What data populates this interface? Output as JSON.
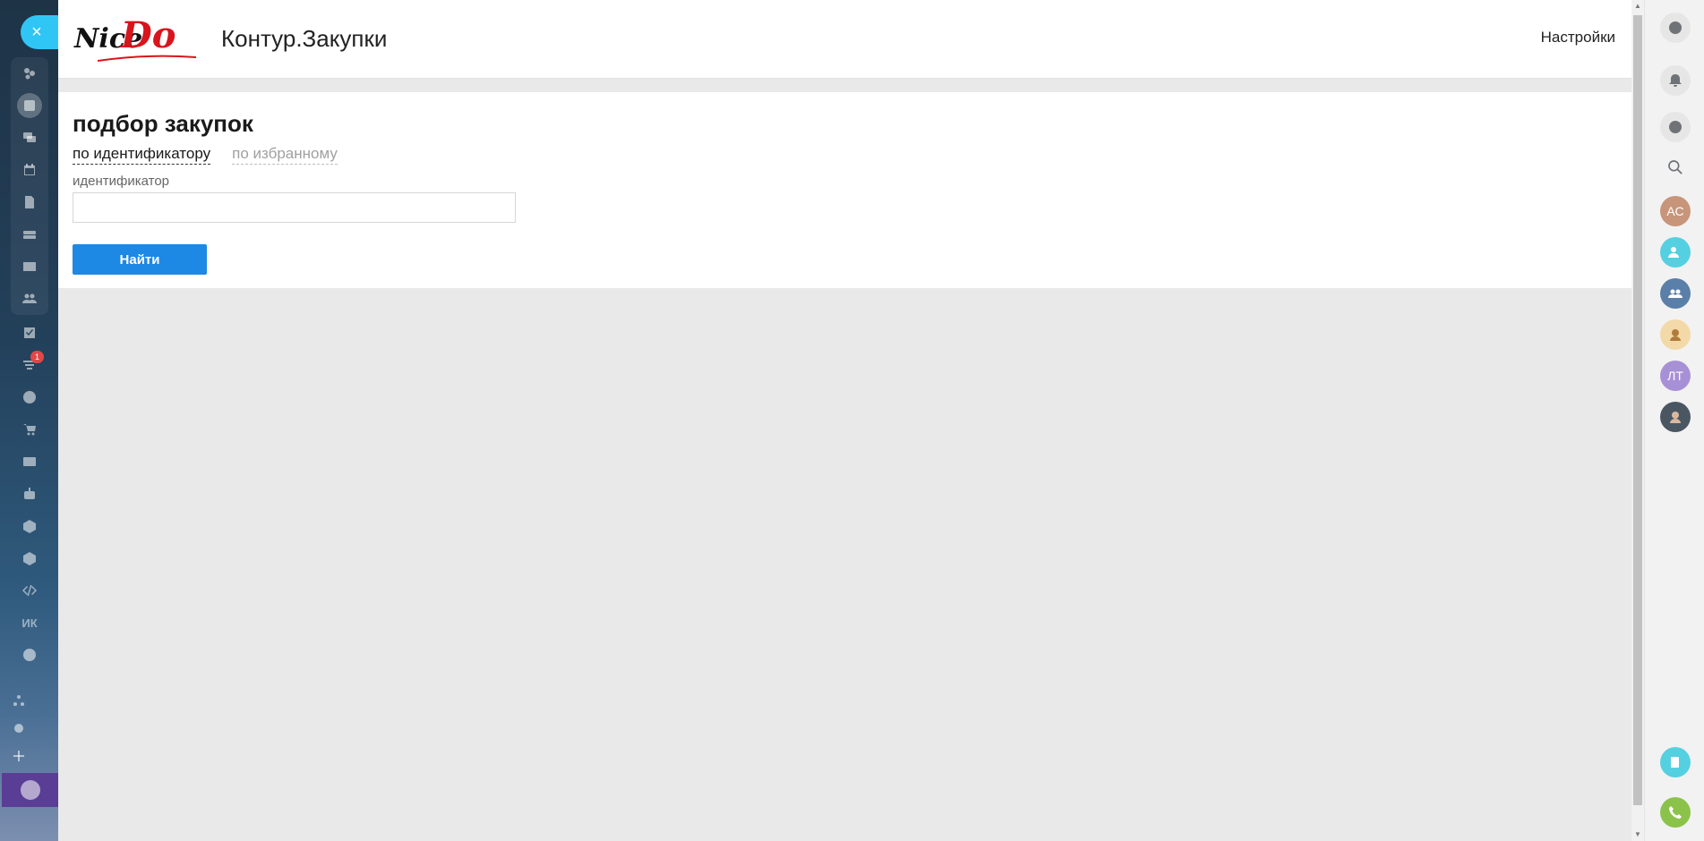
{
  "sidebar_left": {
    "close_symbol": "×",
    "items": [
      {
        "icon": "activity-stream-icon"
      },
      {
        "icon": "feed-icon",
        "active": true
      },
      {
        "icon": "chat-icon"
      },
      {
        "icon": "calendar-icon"
      },
      {
        "icon": "documents-icon"
      },
      {
        "icon": "drive-icon"
      },
      {
        "icon": "mail-icon"
      },
      {
        "icon": "groups-icon"
      },
      {
        "icon": "tasks-icon"
      },
      {
        "icon": "crm-icon",
        "counter": "1"
      },
      {
        "icon": "marketing-icon"
      },
      {
        "icon": "shop-icon"
      },
      {
        "icon": "contact-card-icon"
      },
      {
        "icon": "robot-icon"
      },
      {
        "icon": "box-icon"
      },
      {
        "icon": "box-icon-2"
      },
      {
        "icon": "code-icon"
      },
      {
        "text": "ИК"
      },
      {
        "icon": "more-icon"
      }
    ],
    "bottom": [
      {
        "icon": "sitemap-icon"
      },
      {
        "icon": "settings-icon"
      },
      {
        "icon": "add-icon"
      }
    ]
  },
  "header": {
    "logo_word1": "Nice",
    "logo_word2": "Do",
    "app_title": "Контур.Закупки",
    "settings_label": "Настройки"
  },
  "main": {
    "page_title": "подбор закупок",
    "tabs": [
      {
        "label": "по идентификатору",
        "active": true
      },
      {
        "label": "по избранному",
        "active": false
      }
    ],
    "field_label": "идентификатор",
    "field_value": "",
    "find_button": "Найти"
  },
  "sidebar_right": {
    "avatars": [
      {
        "initials": "АС",
        "color": "#c7957a"
      },
      {
        "initials": "ЛТ",
        "color": "#a890d6"
      }
    ]
  },
  "colors": {
    "accent": "#1e88e5",
    "close_button": "#2fc6f6",
    "counter": "#e34747",
    "phone": "#8bc34a",
    "logo_red": "#d8141c"
  }
}
